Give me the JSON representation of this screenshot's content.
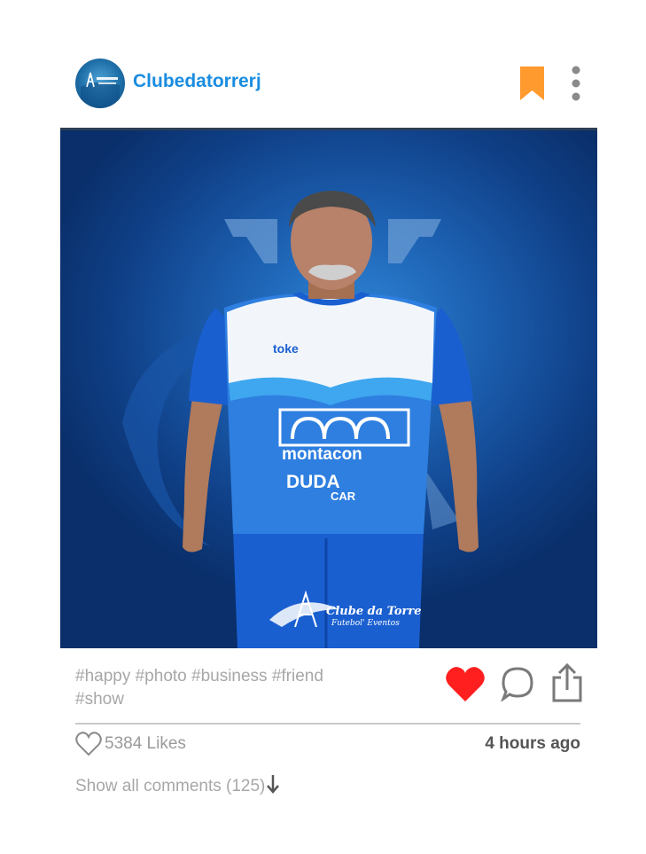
{
  "post": {
    "username": "Clubedatorrerj",
    "avatar_icon": "club-logo-icon",
    "bookmark_icon": "bookmark-icon",
    "more_icon": "more-vertical-icon",
    "photo_texts": {
      "sponsor_1": "montacon",
      "sponsor_2": "DUDA",
      "sponsor_3": "CAR",
      "brand": "toke",
      "club_name": "Clube da Torre",
      "club_tagline": "Futebol' Eventos"
    },
    "caption": "#happy #photo #business #friend #show",
    "actions": {
      "like_icon": "heart-filled-icon",
      "comment_icon": "comment-icon",
      "share_icon": "share-icon"
    },
    "likes_label": "5384 Likes",
    "time_label": "4 hours ago",
    "comments_label": "Show all comments (125)"
  },
  "colors": {
    "username": "#1a8de0",
    "bookmark": "#ff9a2e",
    "heart": "#ff1f1f",
    "muted_text": "#a7a7a7",
    "time_text": "#555555"
  }
}
